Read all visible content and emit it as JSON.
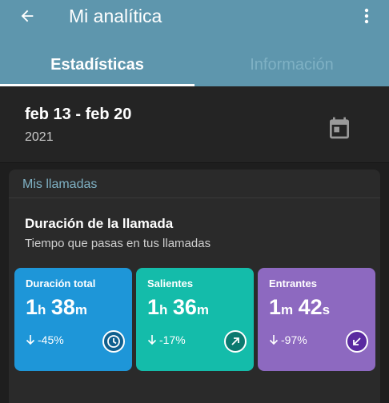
{
  "app_bar": {
    "title": "Mi analítica",
    "back_icon": "arrow-left-icon",
    "menu_icon": "more-vertical-icon",
    "color": "#5e96ad"
  },
  "tabs": [
    {
      "label": "Estadísticas",
      "active": true
    },
    {
      "label": "Información",
      "active": false
    }
  ],
  "date_range": {
    "range": "feb 13 - feb 20",
    "year": "2021",
    "calendar_icon": "calendar-icon"
  },
  "calls_card": {
    "header": "Mis llamadas",
    "title": "Duración de la llamada",
    "subtitle": "Tiempo que pasas en tus llamadas",
    "stats": [
      {
        "label": "Duración total",
        "v1": "1",
        "u1": "h",
        "v2": "38",
        "u2": "m",
        "change": "-45%",
        "icon": "clock-icon",
        "color": "#1e96d8"
      },
      {
        "label": "Salientes",
        "v1": "1",
        "u1": "h",
        "v2": "36",
        "u2": "m",
        "change": "-17%",
        "icon": "outgoing-call-icon",
        "color": "#14bcaa"
      },
      {
        "label": "Entrantes",
        "v1": "1",
        "u1": "m",
        "v2": "42",
        "u2": "s",
        "change": "-97%",
        "icon": "incoming-call-icon",
        "color": "#8d69c0"
      }
    ]
  }
}
